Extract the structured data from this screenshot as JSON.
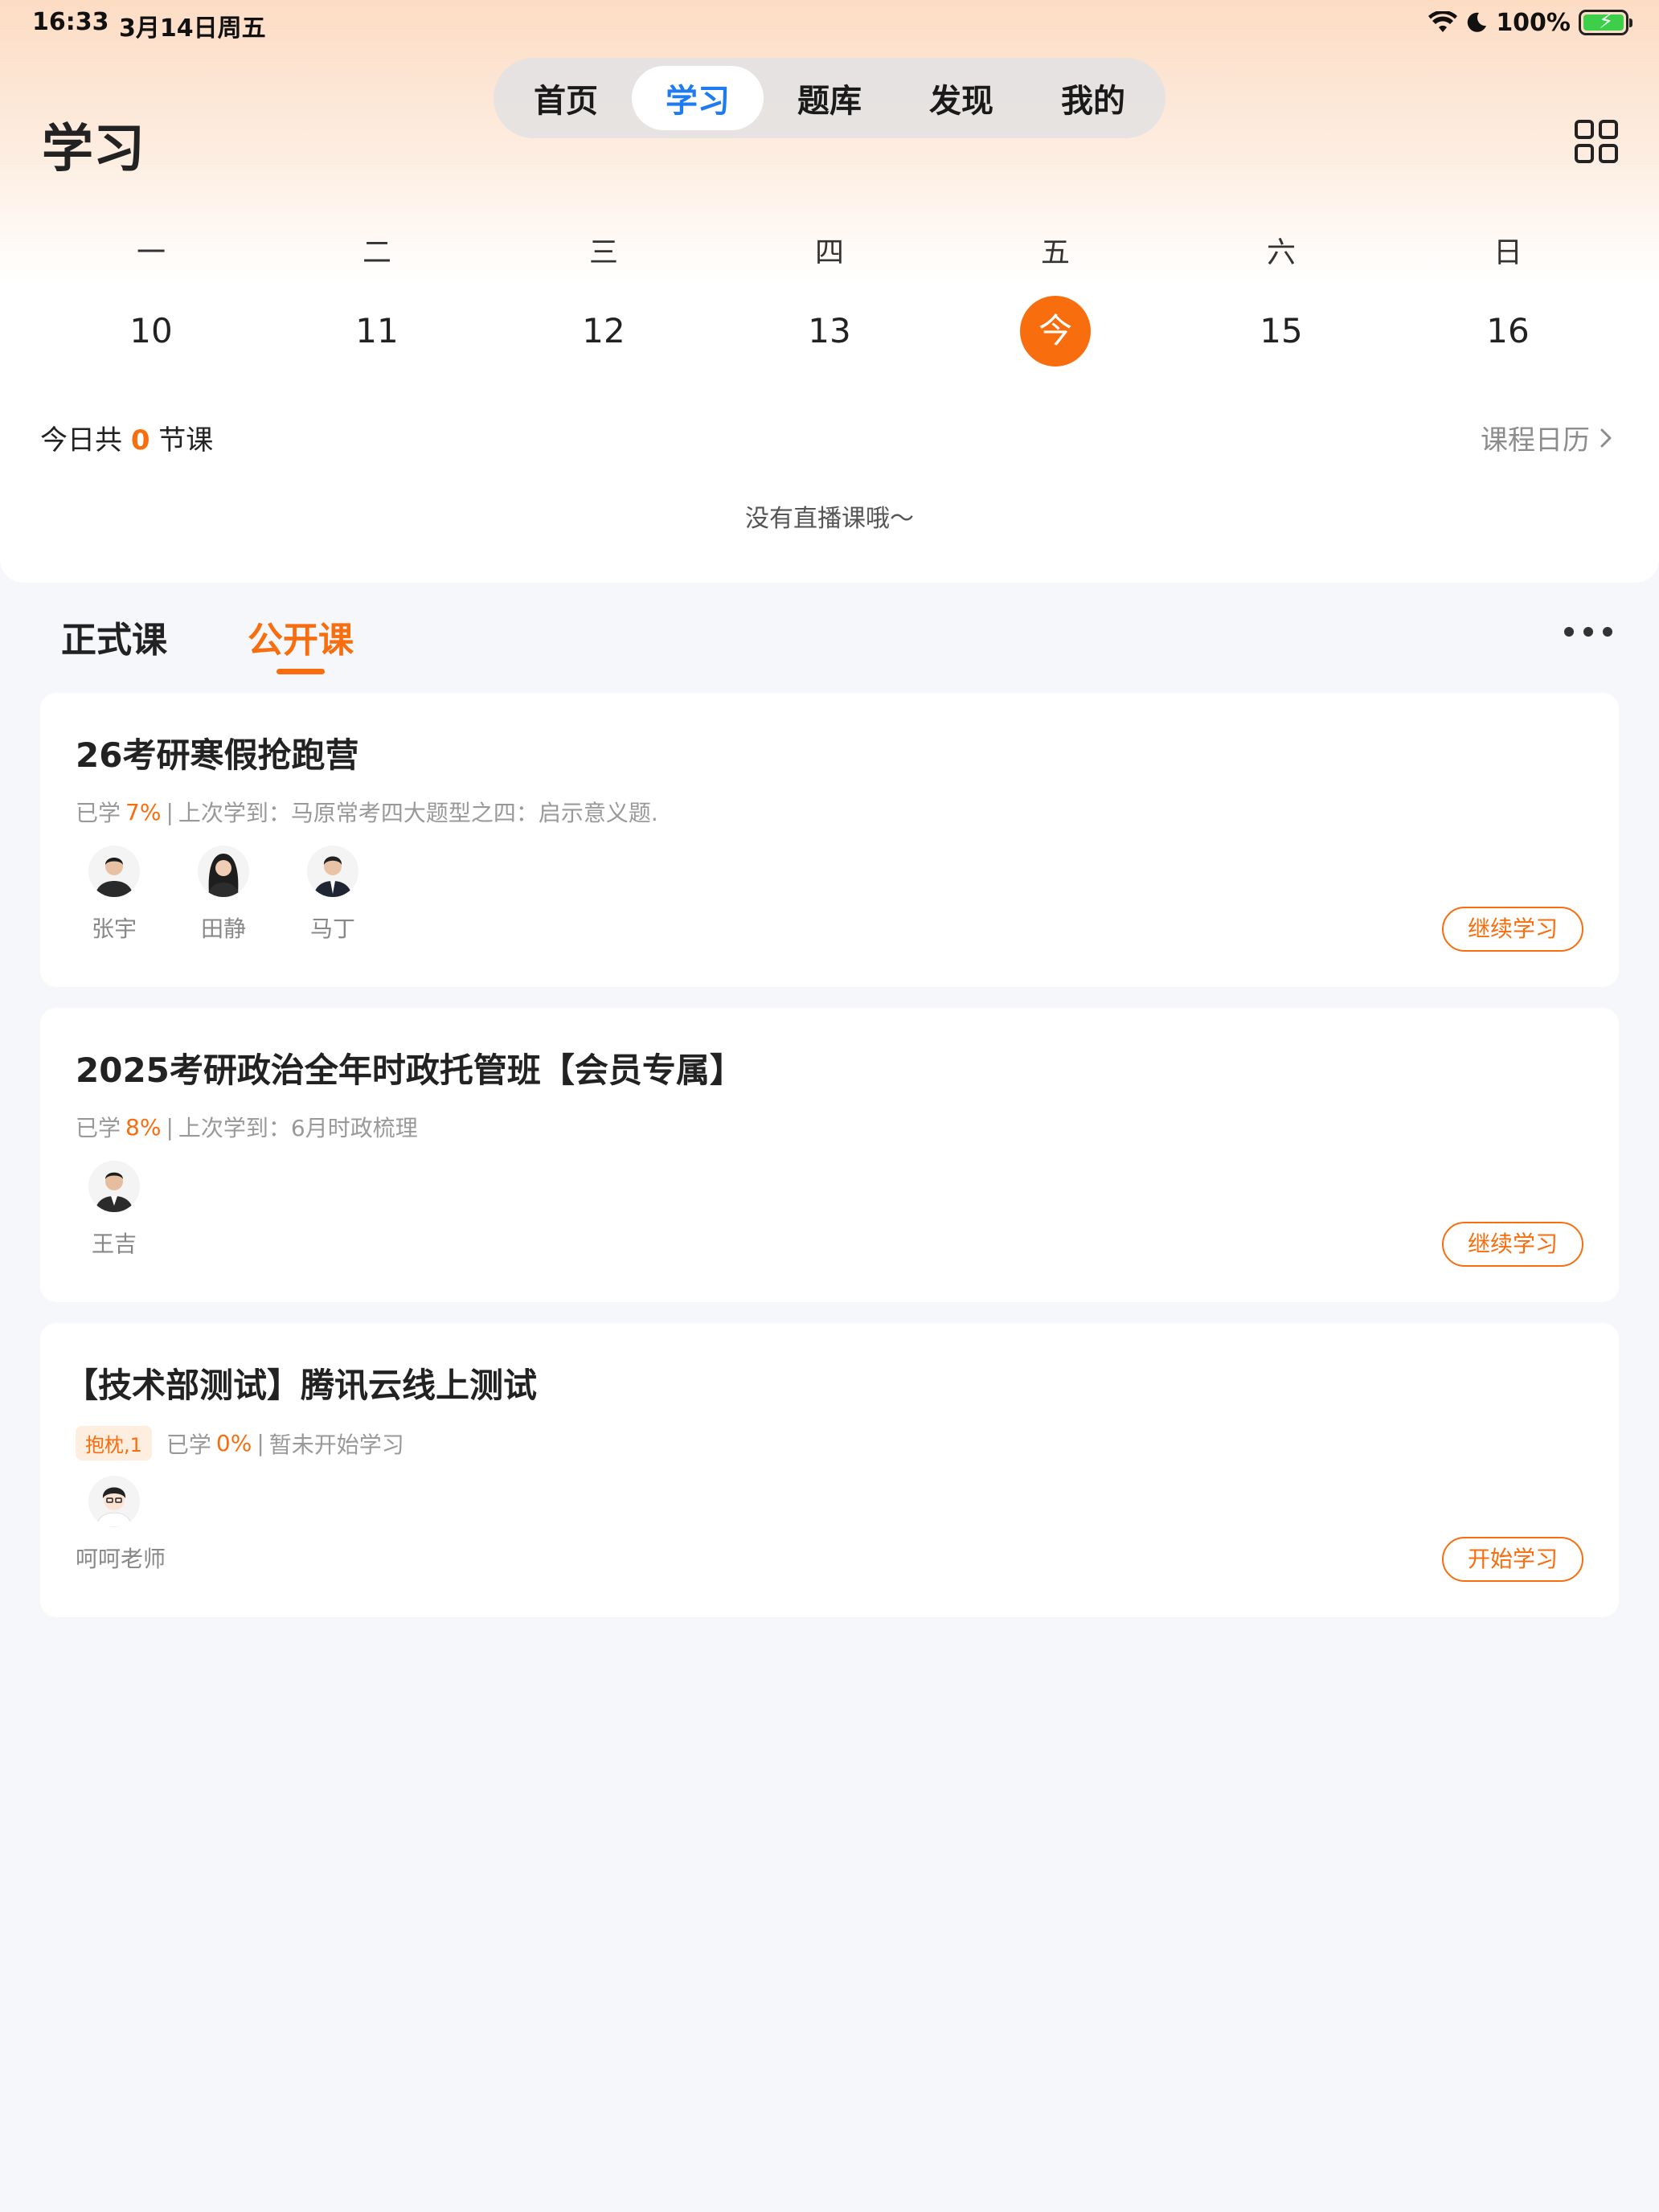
{
  "status_bar": {
    "time": "16:33",
    "date": "3月14日周五",
    "battery": "100%"
  },
  "nav": {
    "tabs": [
      "首页",
      "学习",
      "题库",
      "发现",
      "我的"
    ],
    "active_index": 1
  },
  "page_title": "学习",
  "week": {
    "day_labels": [
      "一",
      "二",
      "三",
      "四",
      "五",
      "六",
      "日"
    ],
    "day_numbers": [
      "10",
      "11",
      "12",
      "13",
      "今",
      "15",
      "16"
    ],
    "today_index": 4
  },
  "today_summary": {
    "prefix": "今日共",
    "count": "0",
    "suffix": "节课"
  },
  "calendar_link": "课程日历",
  "empty_live": "没有直播课哦～",
  "course_tabs": {
    "formal": "正式课",
    "open": "公开课",
    "active": "open"
  },
  "courses": [
    {
      "title": "26考研寒假抢跑营",
      "tag": "",
      "learned_label": "已学",
      "progress": "7%",
      "separator": "|",
      "last_label": "上次学到：马原常考四大题型之四：启示意义题.",
      "teachers": [
        "张宇",
        "田静",
        "马丁"
      ],
      "button": "继续学习"
    },
    {
      "title": "2025考研政治全年时政托管班【会员专属】",
      "tag": "",
      "learned_label": "已学",
      "progress": "8%",
      "separator": "|",
      "last_label": "上次学到：6月时政梳理",
      "teachers": [
        "王吉"
      ],
      "button": "继续学习"
    },
    {
      "title": "【技术部测试】腾讯云线上测试",
      "tag": "抱枕,1",
      "learned_label": "已学",
      "progress": "0%",
      "separator": "|",
      "last_label": "暂未开始学习",
      "teachers": [
        "呵呵老师"
      ],
      "button": "开始学习"
    }
  ],
  "colors": {
    "accent": "#f86d0d",
    "nav_active": "#1e7cf0",
    "background": "#f6f7fb"
  }
}
